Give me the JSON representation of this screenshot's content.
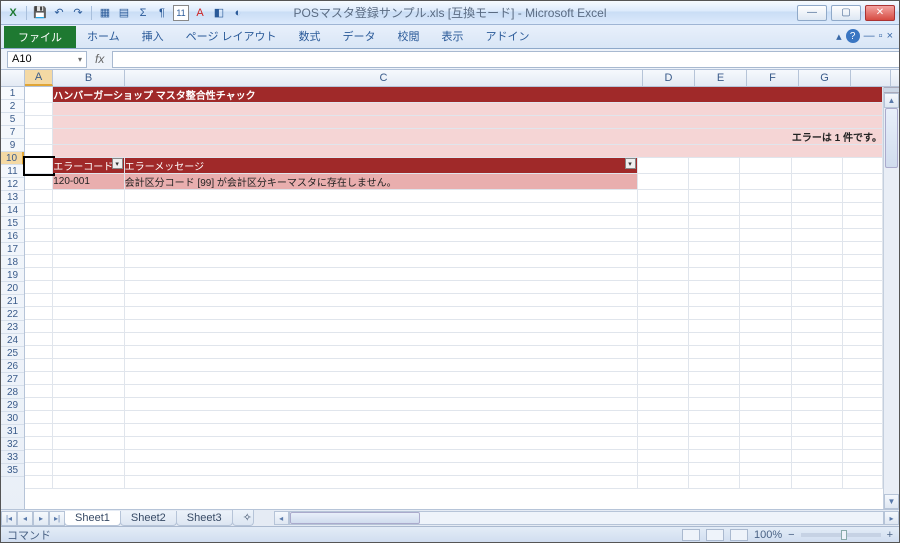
{
  "window": {
    "title": "POSマスタ登録サンプル.xls [互換モード] - Microsoft Excel"
  },
  "qat": {
    "save": "💾",
    "undo": "↶",
    "redo": "↷"
  },
  "ribbon": {
    "file": "ファイル",
    "tabs": [
      "ホーム",
      "挿入",
      "ページ レイアウト",
      "数式",
      "データ",
      "校閲",
      "表示",
      "アドイン"
    ]
  },
  "namebox": {
    "value": "A10"
  },
  "formula": {
    "value": ""
  },
  "columns": [
    "A",
    "B",
    "C",
    "D",
    "E",
    "F",
    "G"
  ],
  "selected_column": "A",
  "rows": [
    1,
    2,
    5,
    7,
    9,
    10,
    11,
    12,
    13,
    14,
    15,
    16,
    17,
    18,
    19,
    20,
    21,
    22,
    23,
    24,
    25,
    26,
    27,
    28,
    29,
    30,
    31,
    32,
    33,
    35
  ],
  "selected_row": 10,
  "sheet": {
    "title": "ハンバーガーショップ  マスタ整合性チャック",
    "error_count_label": "エラーは 1 件です。",
    "table": {
      "headers": {
        "code": "エラーコード",
        "message": "エラーメッセージ"
      },
      "rows": [
        {
          "code": "120-001",
          "message": "会計区分コード [99] が会計区分キーマスタに存在しません。"
        }
      ]
    }
  },
  "sheet_tabs": [
    "Sheet1",
    "Sheet2",
    "Sheet3"
  ],
  "active_sheet": 0,
  "status": {
    "mode": "コマンド",
    "zoom": "100%"
  }
}
